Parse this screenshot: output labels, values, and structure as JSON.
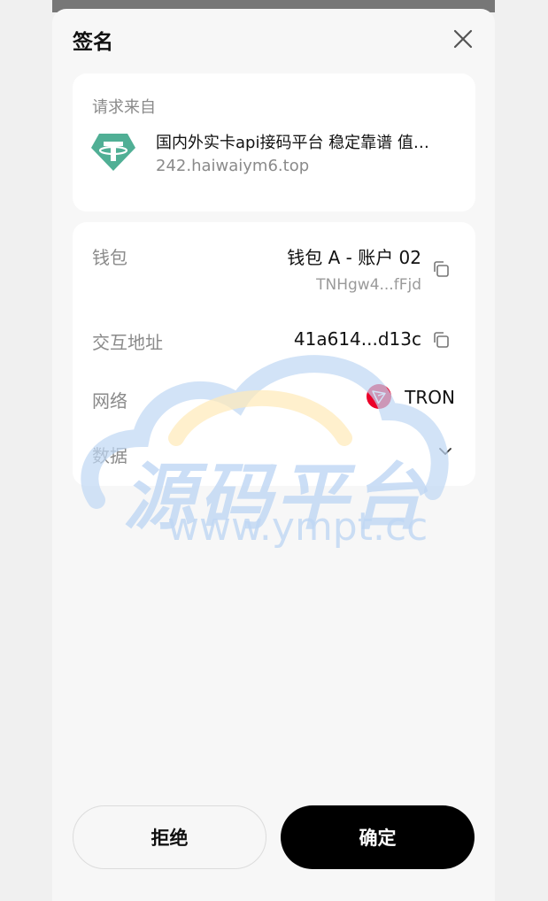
{
  "sheet": {
    "title": "签名",
    "close_icon": "close-icon"
  },
  "request": {
    "label": "请求来自",
    "dapp_icon": "tether-logo",
    "dapp_name": "国内外实卡api接码平台 稳定靠谱 值…",
    "dapp_url": "242.haiwaiym6.top"
  },
  "details": {
    "wallet": {
      "label": "钱包",
      "name": "钱包 A - 账户 02",
      "address": "TNHgw4...fFjd",
      "copy_icon": "copy-icon"
    },
    "contract": {
      "label": "交互地址",
      "address": "41a614...d13c",
      "copy_icon": "copy-icon"
    },
    "network": {
      "label": "网络",
      "name": "TRON",
      "icon": "tron-logo"
    },
    "data": {
      "label": "数据",
      "expand_icon": "chevron-down-icon"
    }
  },
  "watermark": {
    "text_cn": "源码平台",
    "text_url": "www.ympt.cc"
  },
  "actions": {
    "reject_label": "拒绝",
    "confirm_label": "确定"
  },
  "colors": {
    "tether_green": "#50AF95",
    "tron_red": "#EB0029",
    "confirm_bg": "#000000",
    "watermark_blue": "#BFD7F4",
    "watermark_yellow": "#FFE9B8"
  }
}
